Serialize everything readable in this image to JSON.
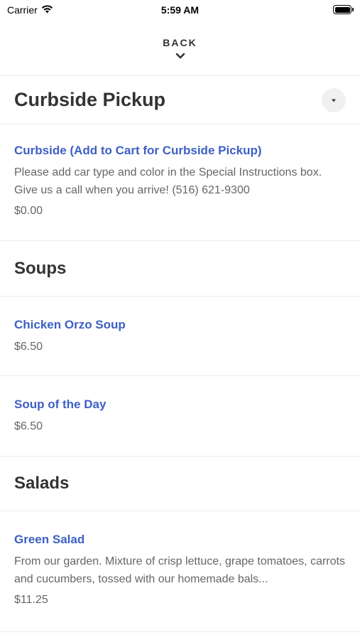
{
  "status": {
    "carrier": "Carrier",
    "time": "5:59 AM"
  },
  "nav": {
    "back_label": "BACK"
  },
  "sections": [
    {
      "title": "Curbside Pickup",
      "items": [
        {
          "name": "Curbside (Add to Cart for Curbside Pickup)",
          "description": "Please add car type and color in the Special Instructions box. Give us a call when you arrive! (516) 621-9300",
          "price": "$0.00"
        }
      ]
    },
    {
      "title": "Soups",
      "items": [
        {
          "name": "Chicken Orzo Soup",
          "price": "$6.50"
        },
        {
          "name": "Soup of the Day",
          "price": "$6.50"
        }
      ]
    },
    {
      "title": "Salads",
      "items": [
        {
          "name": "Green Salad",
          "description": "From our garden. Mixture of crisp lettuce, grape tomatoes, carrots and cucumbers, tossed with our homemade bals...",
          "price": "$11.25"
        }
      ]
    }
  ],
  "colors": {
    "item_link": "#3d5fc4",
    "text_muted": "#666666",
    "divider": "#ececec"
  }
}
